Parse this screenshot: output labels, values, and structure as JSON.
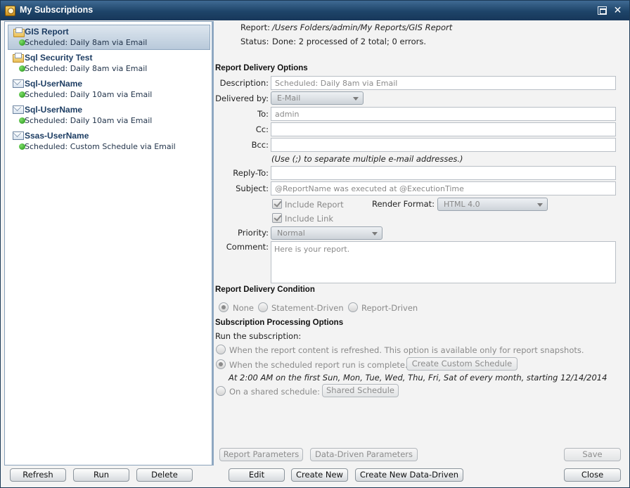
{
  "window": {
    "title": "My Subscriptions"
  },
  "subscriptions": [
    {
      "name": "GIS Report",
      "schedule": "Scheduled: Daily 8am via Email",
      "icon": "report-folder-icon",
      "selected": true
    },
    {
      "name": "Sql Security Test",
      "schedule": "Scheduled: Daily 8am via Email",
      "icon": "report-folder-icon",
      "selected": false
    },
    {
      "name": "Sql-UserName",
      "schedule": "Scheduled: Daily 10am via Email",
      "icon": "report-mail-icon",
      "selected": false
    },
    {
      "name": "Sql-UserName",
      "schedule": "Scheduled: Daily 10am via Email",
      "icon": "report-mail-icon",
      "selected": false
    },
    {
      "name": "Ssas-UserName",
      "schedule": "Scheduled: Custom Schedule via Email",
      "icon": "report-mail-icon",
      "selected": false
    }
  ],
  "left_buttons": {
    "refresh": "Refresh",
    "run": "Run",
    "delete": "Delete"
  },
  "report": {
    "report_label": "Report:",
    "report_path": "/Users Folders/admin/My Reports/GIS Report",
    "status_label": "Status:",
    "status_value": "Done: 2 processed of 2 total; 0 errors."
  },
  "delivery": {
    "section_title": "Report Delivery Options",
    "description_label": "Description:",
    "description_value": "Scheduled: Daily 8am via Email",
    "delivered_by_label": "Delivered by:",
    "delivered_by_value": "E-Mail",
    "to_label": "To:",
    "to_value": "admin",
    "cc_label": "Cc:",
    "cc_value": "",
    "bcc_label": "Bcc:",
    "bcc_value": "",
    "separator_hint": "(Use (;) to separate multiple e-mail addresses.)",
    "reply_to_label": "Reply-To:",
    "reply_to_value": "",
    "subject_label": "Subject:",
    "subject_value": "@ReportName was executed at @ExecutionTime",
    "include_report_label": "Include Report",
    "include_report_checked": true,
    "render_format_label": "Render Format:",
    "render_format_value": "HTML 4.0",
    "include_link_label": "Include Link",
    "include_link_checked": true,
    "priority_label": "Priority:",
    "priority_value": "Normal",
    "comment_label": "Comment:",
    "comment_value": "Here is your report."
  },
  "condition": {
    "section_title": "Report Delivery Condition",
    "options": [
      "None",
      "Statement-Driven",
      "Report-Driven"
    ],
    "selected": "None"
  },
  "processing": {
    "section_title": "Subscription Processing Options",
    "run_label": "Run the subscription:",
    "option_refresh": "When the report content is refreshed. This option is available only for report snapshots.",
    "option_scheduled": "When the scheduled report run is complete.",
    "custom_schedule_button": "Create Custom Schedule",
    "schedule_description": "At 2:00 AM on the first Sun, Mon, Tue, Wed, Thu, Fri, Sat of every month, starting 12/14/2014",
    "option_shared": "On a shared schedule:",
    "shared_schedule_button": "Shared Schedule",
    "selected": "scheduled"
  },
  "right_buttons": {
    "report_parameters": "Report Parameters",
    "data_driven_parameters": "Data-Driven Parameters",
    "save": "Save",
    "edit": "Edit",
    "create_new": "Create New",
    "create_new_data_driven": "Create New Data-Driven",
    "close": "Close"
  }
}
